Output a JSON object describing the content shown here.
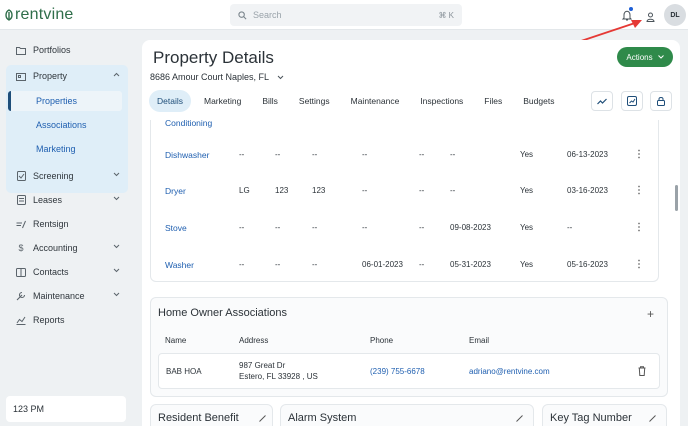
{
  "brand": {
    "name": "rentvine",
    "color": "#2f6e4a"
  },
  "search": {
    "placeholder": "Search",
    "shortcut": "⌘ K"
  },
  "user": {
    "initials": "DL"
  },
  "sidebar": {
    "portfolios": "Portfolios",
    "property": "Property",
    "property_sub": {
      "properties": "Properties",
      "associations": "Associations",
      "marketing": "Marketing"
    },
    "screening": "Screening",
    "leases": "Leases",
    "rentsign": "Rentsign",
    "accounting": "Accounting",
    "contacts": "Contacts",
    "maintenance": "Maintenance",
    "reports": "Reports",
    "time": "123 PM"
  },
  "page": {
    "title": "Property Details",
    "address": "8686 Amour Court Naples, FL",
    "actions_label": "Actions",
    "tabs": [
      "Details",
      "Marketing",
      "Bills",
      "Settings",
      "Maintenance",
      "Inspections",
      "Files",
      "Budgets"
    ]
  },
  "appliances": {
    "partial_row": "Conditioning",
    "rows": [
      {
        "name": "Dishwasher",
        "c1": "--",
        "c2": "--",
        "c3": "--",
        "c4": "--",
        "c5": "--",
        "c6": "--",
        "c7": "Yes",
        "c8": "06-13-2023"
      },
      {
        "name": "Dryer",
        "c1": "LG",
        "c2": "123",
        "c3": "123",
        "c4": "--",
        "c5": "--",
        "c6": "--",
        "c7": "Yes",
        "c8": "03-16-2023"
      },
      {
        "name": "Stove",
        "c1": "--",
        "c2": "--",
        "c3": "--",
        "c4": "--",
        "c5": "--",
        "c6": "09-08-2023",
        "c7": "Yes",
        "c8": "--"
      },
      {
        "name": "Washer",
        "c1": "--",
        "c2": "--",
        "c3": "--",
        "c4": "06-01-2023",
        "c5": "--",
        "c6": "05-31-2023",
        "c7": "Yes",
        "c8": "05-16-2023"
      }
    ]
  },
  "hoa": {
    "title": "Home Owner Associations",
    "add": "+",
    "headers": {
      "name": "Name",
      "address": "Address",
      "phone": "Phone",
      "email": "Email"
    },
    "row": {
      "name": "BAB HOA",
      "address_line1": "987 Great Dr",
      "address_line2": "Estero, FL 33928 , US",
      "phone": "(239) 755-6678",
      "email": "adriano@rentvine.com"
    }
  },
  "cards": {
    "resident_benefit": "Resident Benefit",
    "alarm_system": "Alarm System",
    "key_tag": "Key Tag Number"
  },
  "colors": {
    "accent_green": "#2f8a4a",
    "link_blue": "#1f5fb0",
    "annotation_red": "#e53935"
  }
}
